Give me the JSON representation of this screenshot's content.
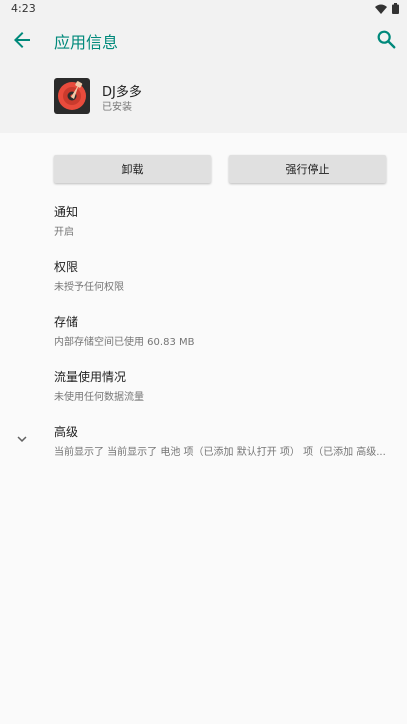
{
  "status_bar": {
    "time": "4:23"
  },
  "app_bar": {
    "title": "应用信息"
  },
  "app": {
    "name": "DJ多多",
    "status": "已安装"
  },
  "buttons": {
    "uninstall": "卸载",
    "force_stop": "强行停止"
  },
  "items": [
    {
      "title": "通知",
      "subtitle": "开启"
    },
    {
      "title": "权限",
      "subtitle": "未授予任何权限"
    },
    {
      "title": "存储",
      "subtitle": "内部存储空间已使用 60.83 MB"
    },
    {
      "title": "流量使用情况",
      "subtitle": "未使用任何数据流量"
    },
    {
      "title": "高级",
      "subtitle": "当前显示了 当前显示了 电池 项（已添加 默认打开 项） 项（已添加 高级..."
    }
  ],
  "colors": {
    "accent": "#00897b",
    "header_bg": "#f2f2f2",
    "background": "#fafafa",
    "button_bg": "#e0e0e0"
  }
}
